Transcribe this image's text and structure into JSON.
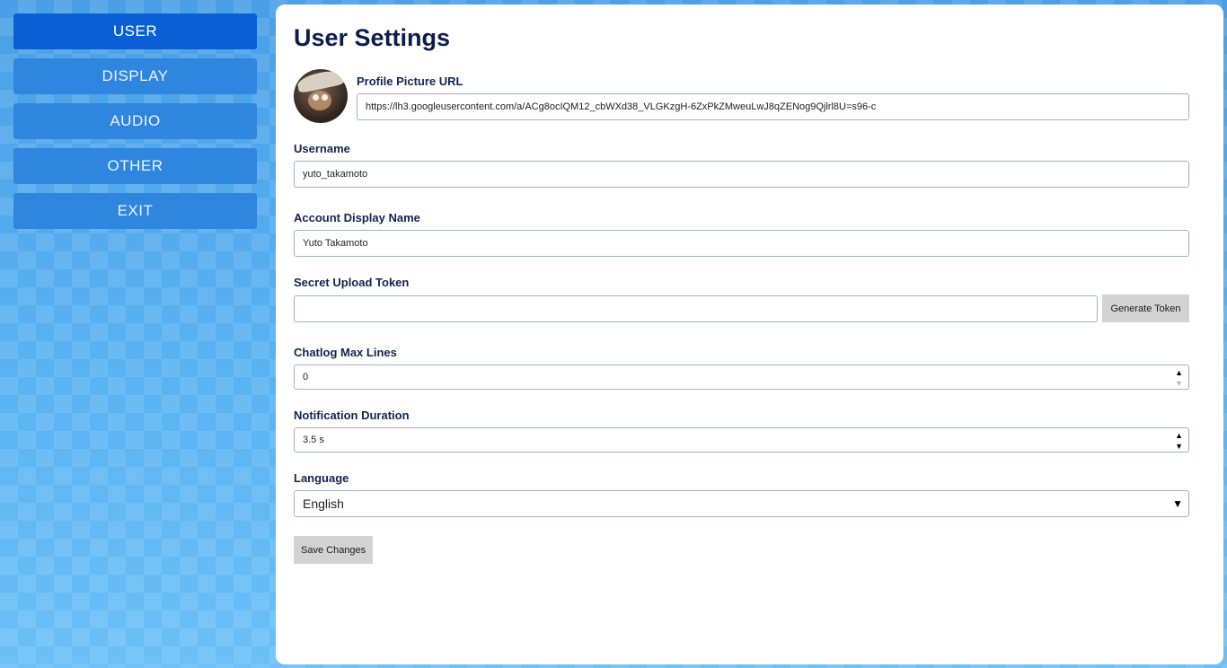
{
  "sidebar": {
    "items": [
      {
        "label": "USER",
        "active": true
      },
      {
        "label": "DISPLAY",
        "active": false
      },
      {
        "label": "AUDIO",
        "active": false
      },
      {
        "label": "OTHER",
        "active": false
      },
      {
        "label": "EXIT",
        "active": false
      }
    ]
  },
  "main": {
    "title": "User Settings",
    "profile_picture": {
      "label": "Profile Picture URL",
      "value": "https://lh3.googleusercontent.com/a/ACg8ocIQM12_cbWXd38_VLGKzgH-6ZxPkZMweuLwJ8qZENog9Qjlrl8U=s96-c"
    },
    "username": {
      "label": "Username",
      "value": "yuto_takamoto"
    },
    "display_name": {
      "label": "Account Display Name",
      "value": "Yuto Takamoto"
    },
    "upload_token": {
      "label": "Secret Upload Token",
      "value": "",
      "button_label": "Generate Token"
    },
    "chatlog_max_lines": {
      "label": "Chatlog Max Lines",
      "value": "0"
    },
    "notification_duration": {
      "label": "Notification Duration",
      "value": "3.5 s"
    },
    "language": {
      "label": "Language",
      "value": "English"
    },
    "save_label": "Save Changes"
  },
  "colors": {
    "active_nav": "#0a5fd6",
    "nav": "#2f86df",
    "title": "#0d1c4a",
    "button": "#d3d3d3"
  },
  "icons": [
    "avatar-image",
    "spin-up-icon",
    "spin-down-icon",
    "dropdown-caret-icon"
  ]
}
